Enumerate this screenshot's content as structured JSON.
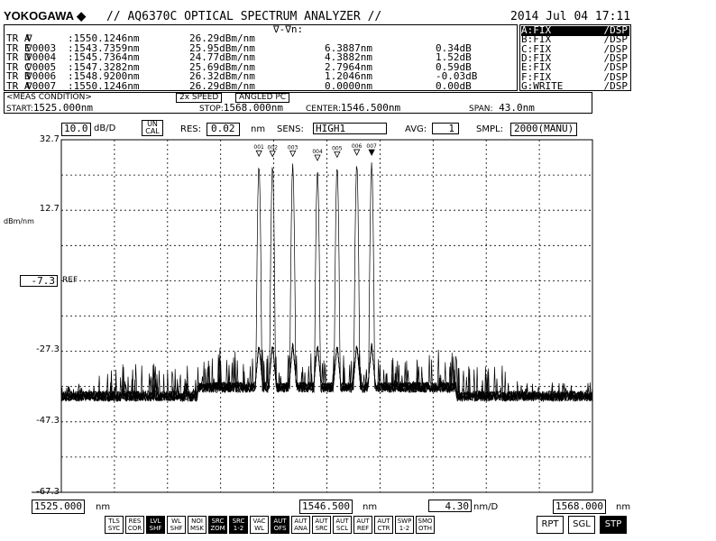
{
  "header": {
    "brand": "YOKOGAWA",
    "brand_symbol": "◆",
    "title": "// AQ6370C OPTICAL SPECTRUM ANALYZER //",
    "datetime": "2014 Jul 04 17:11"
  },
  "markers_table": {
    "delta_label": "∇-∇n:",
    "rows": [
      {
        "trace": "TR A",
        "marker": "∇",
        "wl": ":1550.1246nm",
        "level": "26.29dBm/nm",
        "dwl": "",
        "dlevel": ""
      },
      {
        "trace": "TR E",
        "marker": "∇0003",
        "wl": ":1543.7359nm",
        "level": "25.95dBm/nm",
        "dwl": "6.3887nm",
        "dlevel": "0.34dB"
      },
      {
        "trace": "TR D",
        "marker": "∇0004",
        "wl": ":1545.7364nm",
        "level": "24.77dBm/nm",
        "dwl": "4.3882nm",
        "dlevel": "1.52dB"
      },
      {
        "trace": "TR C",
        "marker": "∇0005",
        "wl": ":1547.3282nm",
        "level": "25.69dBm/nm",
        "dwl": "2.7964nm",
        "dlevel": "0.59dB"
      },
      {
        "trace": "TR B",
        "marker": "∇0006",
        "wl": ":1548.9200nm",
        "level": "26.32dBm/nm",
        "dwl": "1.2046nm",
        "dlevel": "-0.03dB"
      },
      {
        "trace": "TR A",
        "marker": "∇0007",
        "wl": ":1550.1246nm",
        "level": "26.29dBm/nm",
        "dwl": "0.0000nm",
        "dlevel": "0.00dB"
      }
    ]
  },
  "trace_status": [
    {
      "label": "A:FIX",
      "mode": "/DSP",
      "active": true
    },
    {
      "label": "B:FIX",
      "mode": "/DSP",
      "active": false
    },
    {
      "label": "C:FIX",
      "mode": "/DSP",
      "active": false
    },
    {
      "label": "D:FIX",
      "mode": "/DSP",
      "active": false
    },
    {
      "label": "E:FIX",
      "mode": "/DSP",
      "active": false
    },
    {
      "label": "F:FIX",
      "mode": "/DSP",
      "active": false
    },
    {
      "label": "G:WRITE",
      "mode": "/DSP",
      "active": false
    }
  ],
  "meas_condition": {
    "label": "<MEAS CONDITION>",
    "speed": "2x SPEED",
    "connector": "ANGLED PC",
    "start_label": "START:",
    "start": "1525.000nm",
    "stop_label": "STOP:",
    "stop": "1568.000nm",
    "center_label": "CENTER:",
    "center": "1546.500nm",
    "span_label": "SPAN:",
    "span": "43.0nm"
  },
  "settings": {
    "db_div": "10.0",
    "db_div_unit": "dB/D",
    "uncal_1": "UN",
    "uncal_2": "CAL",
    "res_label": "RES:",
    "res": "0.02",
    "res_unit": "nm",
    "sens_label": "SENS:",
    "sens": "HIGH1",
    "avg_label": "AVG:",
    "avg": "1",
    "smpl_label": "SMPL:",
    "smpl": "2000(MANU)"
  },
  "y_axis": {
    "unit": "dBm/nm",
    "ref_value": "-7.3",
    "ref_label": "REF"
  },
  "x_axis": {
    "start": "1525.000",
    "center": "1546.500",
    "stop": "1568.000",
    "unit": "nm",
    "per_div": "4.30",
    "per_div_unit": "nm/D"
  },
  "chart_data": {
    "type": "line",
    "xlim": [
      1525.0,
      1568.0
    ],
    "ylim": [
      -67.3,
      32.7
    ],
    "y_ticks": [
      "32.7",
      "12.7",
      "-7.3",
      "-27.3",
      "-47.3",
      "-67.3"
    ],
    "grid": true,
    "y_unit": "dBm/nm",
    "noise_floor_dbm": -40,
    "channels": [
      {
        "marker": "001",
        "wl": 1541.0,
        "peak": 26.0,
        "style": "open"
      },
      {
        "marker": "002",
        "wl": 1542.1,
        "peak": 25.9,
        "style": "open"
      },
      {
        "marker": "003",
        "wl": 1543.7359,
        "peak": 25.95,
        "style": "open"
      },
      {
        "marker": "004",
        "wl": 1545.7364,
        "peak": 24.77,
        "style": "open"
      },
      {
        "marker": "005",
        "wl": 1547.3282,
        "peak": 25.69,
        "style": "open"
      },
      {
        "marker": "006",
        "wl": 1548.92,
        "peak": 26.32,
        "style": "open"
      },
      {
        "marker": "007",
        "wl": 1550.1246,
        "peak": 26.29,
        "style": "filled"
      }
    ]
  },
  "softkeys": [
    {
      "l1": "TLS",
      "l2": "SYC",
      "on": false
    },
    {
      "l1": "RES",
      "l2": "COR",
      "on": false
    },
    {
      "l1": "LVL",
      "l2": "SHF",
      "on": true
    },
    {
      "l1": "WL",
      "l2": "SHF",
      "on": false
    },
    {
      "l1": "NOI",
      "l2": "MSK",
      "on": false
    },
    {
      "l1": "SRC",
      "l2": "ZOM",
      "on": true
    },
    {
      "l1": "SRC",
      "l2": "1-2",
      "on": true
    },
    {
      "l1": "VAC",
      "l2": "WL",
      "on": false
    },
    {
      "l1": "AUT",
      "l2": "OFS",
      "on": true
    },
    {
      "l1": "AUT",
      "l2": "ANA",
      "on": false
    },
    {
      "l1": "AUT",
      "l2": "SRC",
      "on": false
    },
    {
      "l1": "AUT",
      "l2": "SCL",
      "on": false
    },
    {
      "l1": "AUT",
      "l2": "REF",
      "on": false
    },
    {
      "l1": "AUT",
      "l2": "CTR",
      "on": false
    },
    {
      "l1": "SWP",
      "l2": "1-2",
      "on": false
    },
    {
      "l1": "SMO",
      "l2": "OTH",
      "on": false
    }
  ],
  "sweep_buttons": {
    "rpt": "RPT",
    "sgl": "SGL",
    "stp": "STP"
  }
}
